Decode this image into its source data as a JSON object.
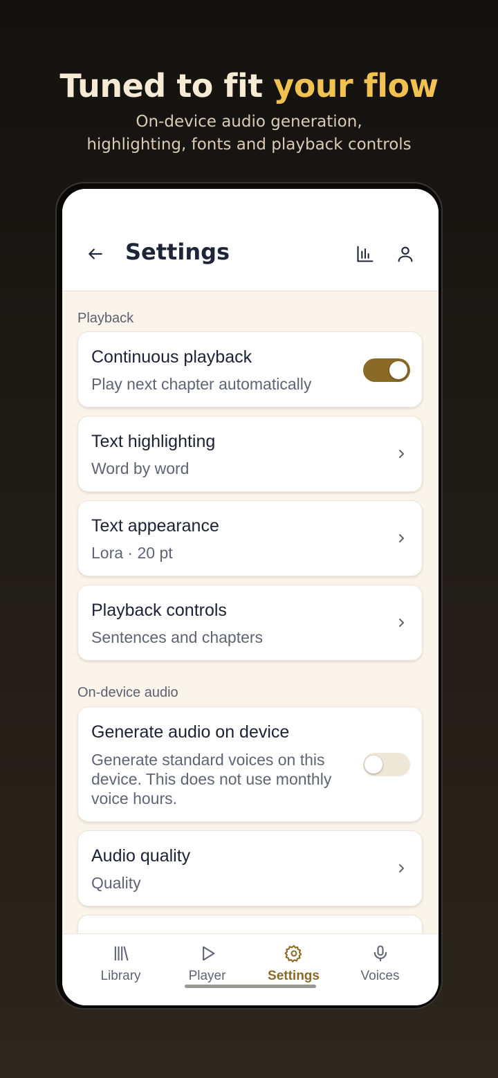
{
  "promo": {
    "headline_part1": "Tuned to fit ",
    "headline_part2": "your flow",
    "subline_line1": "On-device audio generation,",
    "subline_line2": "highlighting, fonts and playback controls"
  },
  "appbar": {
    "title": "Settings",
    "back_icon": "arrow-left-icon",
    "stats_icon": "bar-chart-icon",
    "profile_icon": "person-icon"
  },
  "sections": {
    "playback": "Playback",
    "on_device_audio": "On-device audio"
  },
  "settings": {
    "continuous_playback": {
      "title": "Continuous playback",
      "subtitle": "Play next chapter automatically",
      "enabled": true
    },
    "text_highlighting": {
      "title": "Text highlighting",
      "subtitle": "Word by word"
    },
    "text_appearance": {
      "title": "Text appearance",
      "subtitle": "Lora · 20 pt"
    },
    "playback_controls": {
      "title": "Playback controls",
      "subtitle": "Sentences and chapters"
    },
    "generate_audio": {
      "title": "Generate audio on device",
      "description": "Generate standard voices on this device. This does not use monthly voice hours.",
      "enabled": false
    },
    "audio_quality": {
      "title": "Audio quality",
      "subtitle": "Quality"
    }
  },
  "bottom_nav": {
    "library": "Library",
    "player": "Player",
    "settings": "Settings",
    "voices": "Voices",
    "active": "settings"
  },
  "colors": {
    "accent": "#8a6a26",
    "headline_highlight": "#f1c152",
    "screen_background": "#fbf4ea"
  }
}
